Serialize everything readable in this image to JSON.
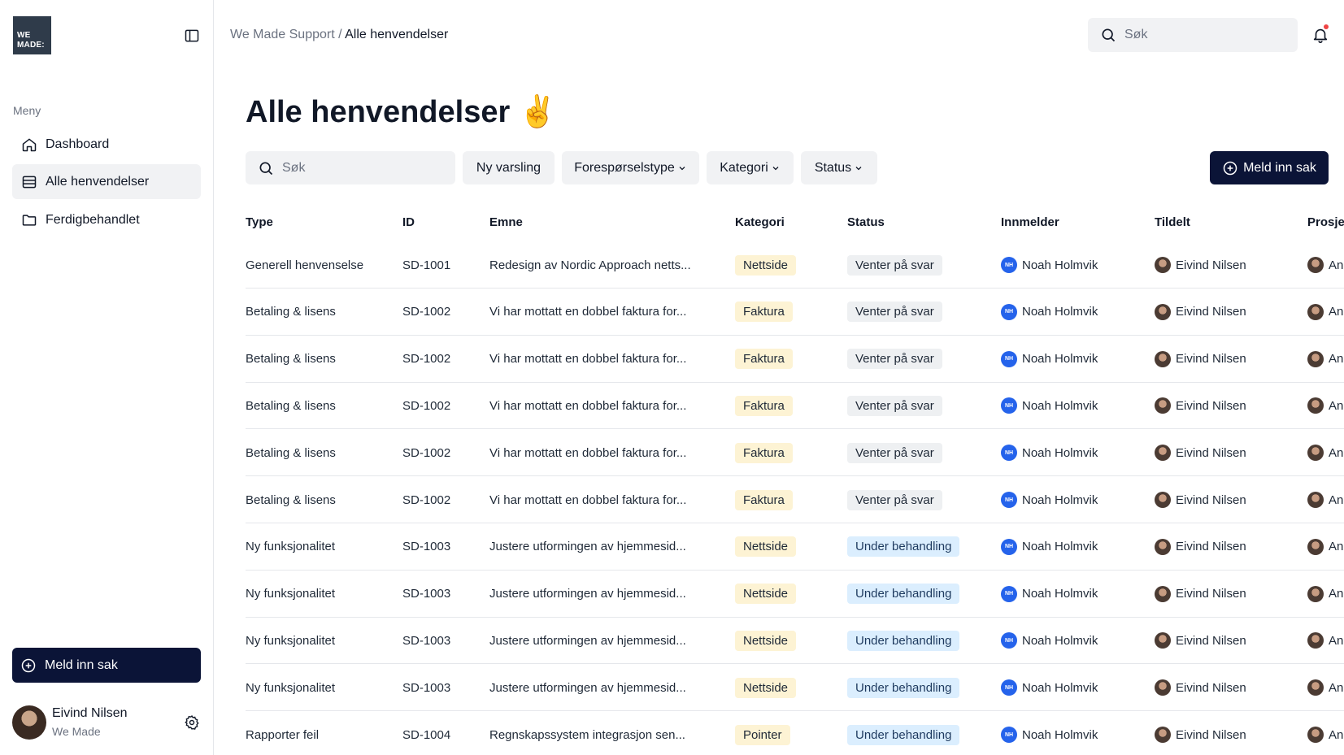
{
  "sidebar": {
    "logo_line1": "WE",
    "logo_line2": "MADE:",
    "menu_title": "Meny",
    "items": [
      {
        "label": "Dashboard"
      },
      {
        "label": "Alle henvendelser"
      },
      {
        "label": "Ferdigbehandlet"
      }
    ],
    "cta_label": "Meld inn sak",
    "user": {
      "name": "Eivind Nilsen",
      "org": "We Made"
    }
  },
  "header": {
    "breadcrumb_root": "We Made Support /",
    "breadcrumb_current": "Alle henvendelser",
    "search_placeholder": "Søk"
  },
  "main": {
    "title": "Alle henvendelser ✌️",
    "search_placeholder": "Søk",
    "filters": [
      "Ny varsling",
      "Forespørselstype",
      "Kategori",
      "Status"
    ],
    "cta_label": "Meld inn sak",
    "columns": [
      "Type",
      "ID",
      "Emne",
      "Kategori",
      "Status",
      "Innmelder",
      "Tildelt",
      "Prosje"
    ],
    "rows": [
      {
        "type": "Generell henvenselse",
        "id": "SD-1001",
        "subject": "Redesign av Nordic Approach netts...",
        "category": "Nettside",
        "status": "Venter på svar",
        "status_style": "grey",
        "reporter_initials": "NH",
        "reporter": "Noah Holmvik",
        "assignee": "Eivind Nilsen",
        "project": "An"
      },
      {
        "type": "Betaling & lisens",
        "id": "SD-1002",
        "subject": "Vi har mottatt en dobbel faktura for...",
        "category": "Faktura",
        "status": "Venter på svar",
        "status_style": "grey",
        "reporter_initials": "NH",
        "reporter": "Noah Holmvik",
        "assignee": "Eivind Nilsen",
        "project": "An"
      },
      {
        "type": "Betaling & lisens",
        "id": "SD-1002",
        "subject": "Vi har mottatt en dobbel faktura for...",
        "category": "Faktura",
        "status": "Venter på svar",
        "status_style": "grey",
        "reporter_initials": "NH",
        "reporter": "Noah Holmvik",
        "assignee": "Eivind Nilsen",
        "project": "An"
      },
      {
        "type": "Betaling & lisens",
        "id": "SD-1002",
        "subject": "Vi har mottatt en dobbel faktura for...",
        "category": "Faktura",
        "status": "Venter på svar",
        "status_style": "grey",
        "reporter_initials": "NH",
        "reporter": "Noah Holmvik",
        "assignee": "Eivind Nilsen",
        "project": "An"
      },
      {
        "type": "Betaling & lisens",
        "id": "SD-1002",
        "subject": "Vi har mottatt en dobbel faktura for...",
        "category": "Faktura",
        "status": "Venter på svar",
        "status_style": "grey",
        "reporter_initials": "NH",
        "reporter": "Noah Holmvik",
        "assignee": "Eivind Nilsen",
        "project": "An"
      },
      {
        "type": "Betaling & lisens",
        "id": "SD-1002",
        "subject": "Vi har mottatt en dobbel faktura for...",
        "category": "Faktura",
        "status": "Venter på svar",
        "status_style": "grey",
        "reporter_initials": "NH",
        "reporter": "Noah Holmvik",
        "assignee": "Eivind Nilsen",
        "project": "An"
      },
      {
        "type": "Ny funksjonalitet",
        "id": "SD-1003",
        "subject": "Justere utformingen av hjemmesid...",
        "category": "Nettside",
        "status": "Under behandling",
        "status_style": "blue",
        "reporter_initials": "NH",
        "reporter": "Noah Holmvik",
        "assignee": "Eivind Nilsen",
        "project": "An"
      },
      {
        "type": "Ny funksjonalitet",
        "id": "SD-1003",
        "subject": "Justere utformingen av hjemmesid...",
        "category": "Nettside",
        "status": "Under behandling",
        "status_style": "blue",
        "reporter_initials": "NH",
        "reporter": "Noah Holmvik",
        "assignee": "Eivind Nilsen",
        "project": "An"
      },
      {
        "type": "Ny funksjonalitet",
        "id": "SD-1003",
        "subject": "Justere utformingen av hjemmesid...",
        "category": "Nettside",
        "status": "Under behandling",
        "status_style": "blue",
        "reporter_initials": "NH",
        "reporter": "Noah Holmvik",
        "assignee": "Eivind Nilsen",
        "project": "An"
      },
      {
        "type": "Ny funksjonalitet",
        "id": "SD-1003",
        "subject": "Justere utformingen av hjemmesid...",
        "category": "Nettside",
        "status": "Under behandling",
        "status_style": "blue",
        "reporter_initials": "NH",
        "reporter": "Noah Holmvik",
        "assignee": "Eivind Nilsen",
        "project": "An"
      },
      {
        "type": "Rapporter feil",
        "id": "SD-1004",
        "subject": "Regnskapssystem integrasjon sen...",
        "category": "Pointer",
        "status": "Under behandling",
        "status_style": "blue",
        "reporter_initials": "NH",
        "reporter": "Noah Holmvik",
        "assignee": "Eivind Nilsen",
        "project": "An"
      }
    ]
  },
  "colors": {
    "primary": "#0b1437",
    "avatar_blue": "#2563eb",
    "notification_dot": "#ef4444"
  },
  "icons": [
    "sidebar-toggle-icon",
    "home-icon",
    "list-icon",
    "folder-icon",
    "plus-circle-icon",
    "gear-icon",
    "search-icon",
    "bell-icon",
    "chevron-down-icon"
  ]
}
